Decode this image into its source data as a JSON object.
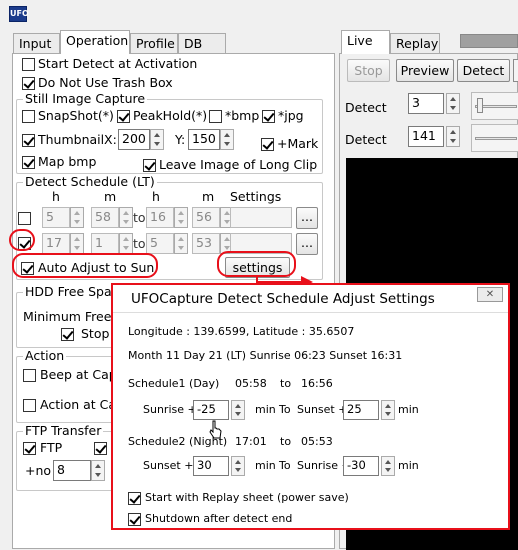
{
  "app": {
    "icon_text": "UFO"
  },
  "left_tabs": [
    "Input",
    "Operation",
    "Profile",
    "DB"
  ],
  "operation": {
    "start_detect": "Start Detect at Activation",
    "no_trash": "Do Not Use Trash Box",
    "still": {
      "title": "Still Image Capture",
      "snapshot": "SnapShot(*)",
      "peakhold": "PeakHold(*)",
      "bmp": "*bmp",
      "jpg": "*jpg",
      "thumbnail": "Thumbnail",
      "x_label": "X:",
      "x_val": "200",
      "y_label": "Y:",
      "y_val": "150",
      "mark": "+Mark",
      "map_bmp": "Map bmp",
      "leave_long": "Leave Image of Long Clip"
    },
    "schedule": {
      "title": "Detect Schedule (LT)",
      "col_h": "h",
      "col_m": "m",
      "col_h2": "h",
      "col_m2": "m",
      "col_settings": "Settings",
      "to": "to",
      "row1": {
        "h1": "5",
        "m1": "58",
        "h2": "16",
        "m2": "56"
      },
      "row2": {
        "h1": "17",
        "m1": "1",
        "h2": "5",
        "m2": "53"
      },
      "ellipsis": "...",
      "auto_adjust": "Auto Adjust to Sun",
      "settings_btn": "settings"
    },
    "hdd": {
      "title": "HDD Free Spac",
      "min_free": "Minimum Free",
      "stop": "Stop"
    },
    "action": {
      "title": "Action",
      "beep": "Beep at Capt",
      "action_at": "Action at Ca"
    },
    "ftp": {
      "title": "FTP Transfer",
      "ftp": "FTP",
      "no_label": "+no",
      "no_val": "8"
    }
  },
  "right": {
    "tabs": [
      "Live",
      "Replay"
    ],
    "stop": "Stop",
    "preview": "Preview",
    "detect_btn": "Detect",
    "detect1_label": "Detect",
    "detect1_val": "3",
    "detect2_label": "Detect",
    "detect2_val": "141"
  },
  "dialog": {
    "title": "UFOCapture Detect Schedule Adjust Settings",
    "close": "✕",
    "coords": "Longitude : 139.6599, Latitude : 35.6507",
    "date_line": "Month 11  Day 21 (LT)  Sunrise 06:23  Sunset 16:31",
    "sched1": {
      "label": "Schedule1 (Day)",
      "start": "05:58",
      "to": "to",
      "end": "16:56"
    },
    "row1": {
      "a": "Sunrise +",
      "a_val": "-25",
      "min": "min",
      "to": "To",
      "b": "Sunset +",
      "b_val": "25",
      "min2": "min"
    },
    "sched2": {
      "label": "Schedule2 (Night)",
      "start": "17:01",
      "to": "to",
      "end": "05:53"
    },
    "row2": {
      "a": "Sunset +",
      "a_val": "30",
      "min": "min",
      "to": "To",
      "b": "Sunrise +",
      "b_val": "-30",
      "min2": "min"
    },
    "replay": "Start with Replay sheet (power save)",
    "shutdown": "Shutdown after detect end"
  },
  "colors": {
    "annotation": "#e8101a",
    "video_bg": "#000000"
  }
}
